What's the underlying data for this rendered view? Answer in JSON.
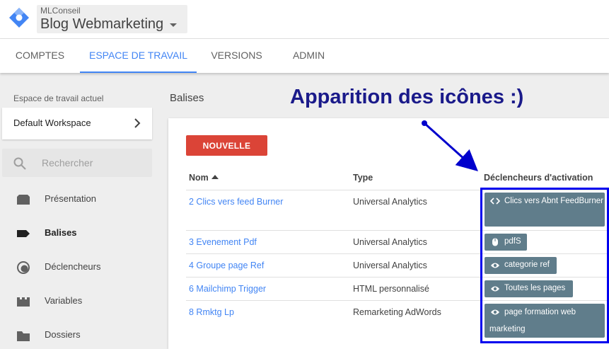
{
  "header": {
    "account_name": "MLConseil",
    "container_name": "Blog Webmarketing"
  },
  "tabs": [
    {
      "label": "COMPTES"
    },
    {
      "label": "ESPACE DE TRAVAIL",
      "active": true
    },
    {
      "label": "VERSIONS"
    },
    {
      "label": "ADMIN"
    }
  ],
  "sidebar": {
    "workspace_label": "Espace de travail actuel",
    "workspace_name": "Default Workspace",
    "search_placeholder": "Rechercher",
    "items": [
      {
        "label": "Présentation",
        "icon": "overview-icon"
      },
      {
        "label": "Balises",
        "icon": "tag-icon",
        "active": true
      },
      {
        "label": "Déclencheurs",
        "icon": "trigger-icon"
      },
      {
        "label": "Variables",
        "icon": "variables-icon"
      },
      {
        "label": "Dossiers",
        "icon": "folder-icon"
      }
    ]
  },
  "main": {
    "title": "Balises",
    "new_button": "NOUVELLE",
    "columns": {
      "name": "Nom",
      "type": "Type",
      "triggers": "Déclencheurs d'activation"
    },
    "rows": [
      {
        "name": "2 Clics vers feed Burner",
        "type": "Universal Analytics",
        "trigger": "Clics vers Abnt FeedBurner",
        "trigger_icon": "code-icon"
      },
      {
        "name": "3 Evenement Pdf",
        "type": "Universal Analytics",
        "trigger": "pdfS",
        "trigger_icon": "mouse-icon"
      },
      {
        "name": "4 Groupe page Ref",
        "type": "Universal Analytics",
        "trigger": "categorie ref",
        "trigger_icon": "eye-icon"
      },
      {
        "name": "6 Mailchimp Trigger",
        "type": "HTML personnalisé",
        "trigger": "Toutes les pages",
        "trigger_icon": "eye-icon"
      },
      {
        "name": "8 Rmktg Lp",
        "type": "Remarketing AdWords",
        "trigger": "page formation web marketing",
        "trigger_icon": "eye-icon"
      }
    ]
  },
  "annotation": {
    "text": "Apparition des icônes :)"
  },
  "colors": {
    "accent": "#4285f4",
    "new_button": "#db4437",
    "chip": "#607d8b",
    "highlight_box": "#0000ee",
    "annotation": "#1a1a8a"
  }
}
